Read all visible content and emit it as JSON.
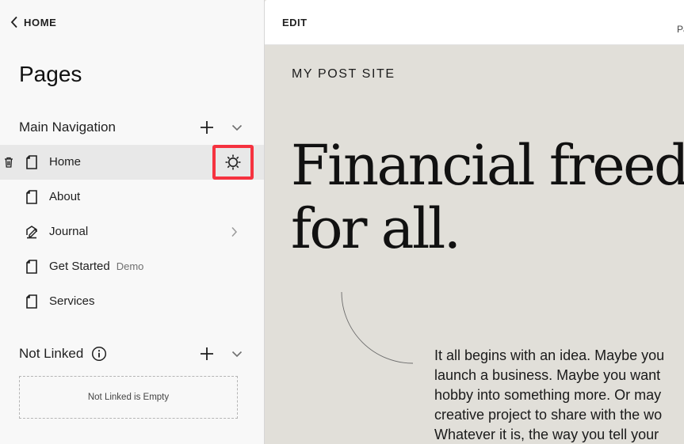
{
  "sidebar": {
    "back_label": "HOME",
    "title": "Pages",
    "main_navigation": {
      "title": "Main Navigation",
      "items": [
        {
          "label": "Home",
          "tag": ""
        },
        {
          "label": "About",
          "tag": ""
        },
        {
          "label": "Journal",
          "tag": ""
        },
        {
          "label": "Get Started",
          "tag": "Demo"
        },
        {
          "label": "Services",
          "tag": ""
        }
      ]
    },
    "not_linked": {
      "title": "Not Linked",
      "empty_text": "Not Linked is Empty"
    }
  },
  "editor": {
    "edit_label": "EDIT",
    "bar_right_text": "Pa",
    "site_title": "MY POST SITE",
    "hero_line1": "Financial freed",
    "hero_line2": "for all.",
    "body_lines": [
      "It all begins with an idea. Maybe you",
      "launch a business. Maybe you want",
      "hobby into something more. Or may",
      "creative project to share with the wo",
      "Whatever it is, the way you tell your"
    ]
  },
  "colors": {
    "highlight": "#f5323f",
    "canvas_bg": "#e1dfd9",
    "sidebar_bg": "#f8f8f8",
    "active_row_bg": "#e8e8e8"
  },
  "icons": {
    "back": "chevron-left-icon",
    "add": "plus-icon",
    "collapse": "chevron-down-icon",
    "page": "page-icon",
    "blog": "blog-icon",
    "delete": "trash-icon",
    "settings": "gear-icon",
    "info": "info-icon",
    "expand": "chevron-right-icon"
  }
}
